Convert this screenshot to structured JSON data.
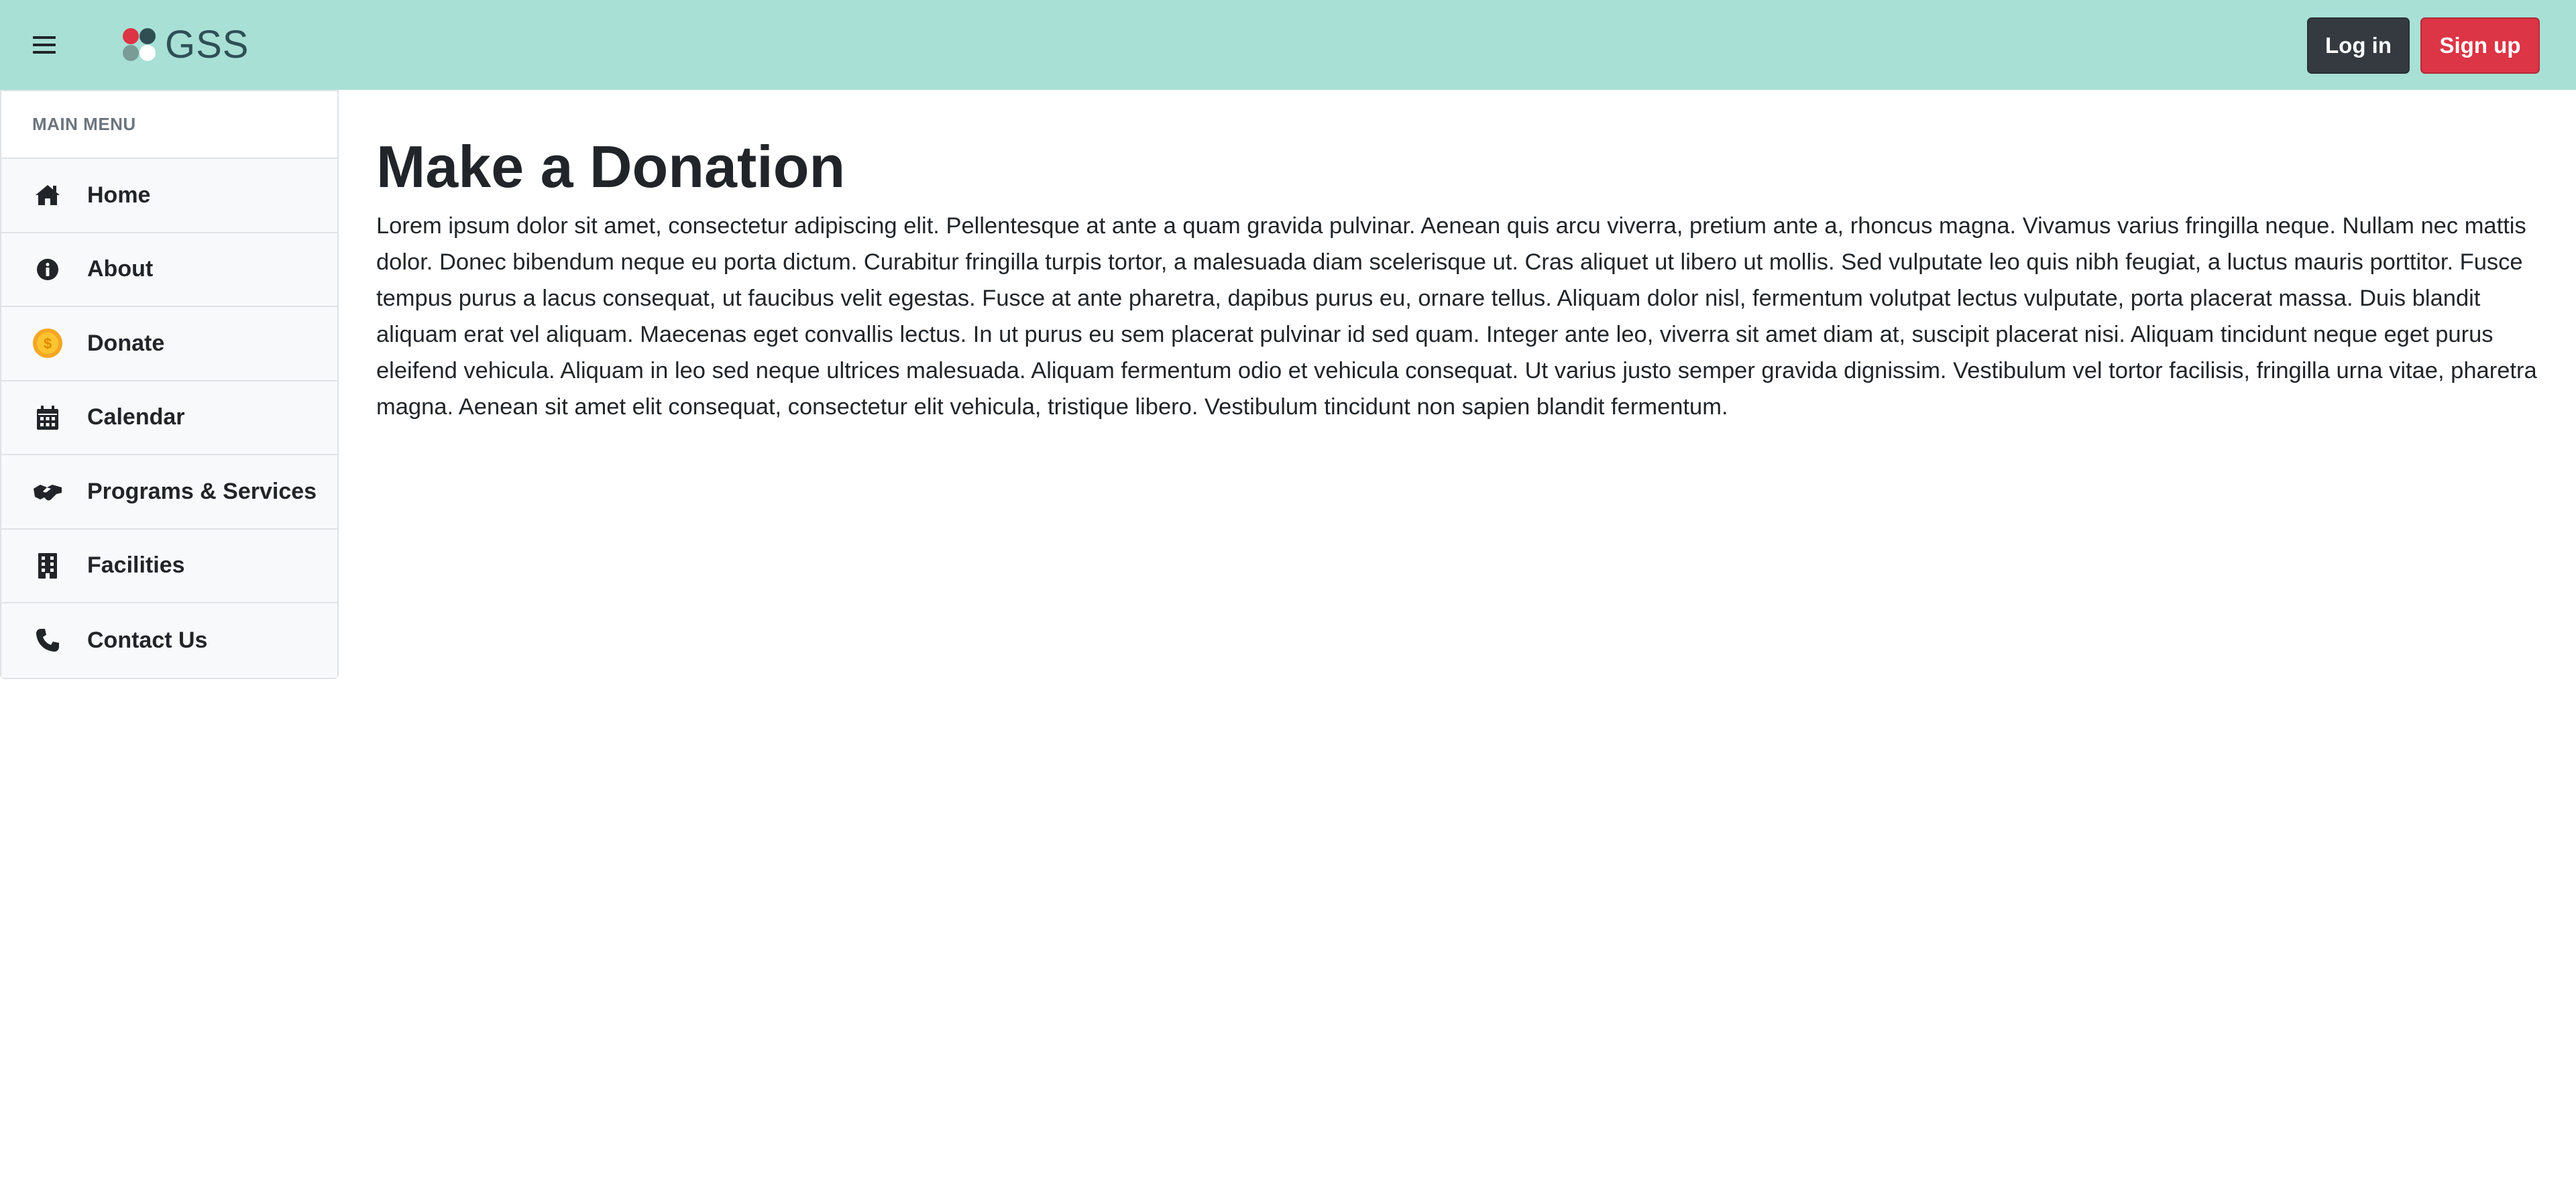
{
  "header": {
    "brand_text": "GSS",
    "login_label": "Log in",
    "signup_label": "Sign up",
    "menu_icon": "hamburger-icon",
    "logo_colors": [
      "#dc3545",
      "#2f4f55",
      "#7a9c97",
      "#ffffff"
    ],
    "background_color": "#a8e0d6"
  },
  "sidebar": {
    "header": "MAIN MENU",
    "items": [
      {
        "label": "Home",
        "icon": "home-icon"
      },
      {
        "label": "About",
        "icon": "info-icon"
      },
      {
        "label": "Donate",
        "icon": "coin-icon"
      },
      {
        "label": "Calendar",
        "icon": "calendar-icon"
      },
      {
        "label": "Programs & Services",
        "icon": "handshake-icon"
      },
      {
        "label": "Facilities",
        "icon": "building-icon"
      },
      {
        "label": "Contact Us",
        "icon": "phone-icon"
      }
    ]
  },
  "main": {
    "title": "Make a Donation",
    "body": "Lorem ipsum dolor sit amet, consectetur adipiscing elit. Pellentesque at ante a quam gravida pulvinar. Aenean quis arcu viverra, pretium ante a, rhoncus magna. Vivamus varius fringilla neque. Nullam nec mattis dolor. Donec bibendum neque eu porta dictum. Curabitur fringilla turpis tortor, a malesuada diam scelerisque ut. Cras aliquet ut libero ut mollis. Sed vulputate leo quis nibh feugiat, a luctus mauris porttitor. Fusce tempus purus a lacus consequat, ut faucibus velit egestas. Fusce at ante pharetra, dapibus purus eu, ornare tellus. Aliquam dolor nisl, fermentum volutpat lectus vulputate, porta placerat massa. Duis blandit aliquam erat vel aliquam. Maecenas eget convallis lectus. In ut purus eu sem placerat pulvinar id sed quam. Integer ante leo, viverra sit amet diam at, suscipit placerat nisi. Aliquam tincidunt neque eget purus eleifend vehicula. Aliquam in leo sed neque ultrices malesuada. Aliquam fermentum odio et vehicula consequat. Ut varius justo semper gravida dignissim. Vestibulum vel tortor facilisis, fringilla urna vitae, pharetra magna. Aenean sit amet elit consequat, consectetur elit vehicula, tristique libero. Vestibulum tincidunt non sapien blandit fermentum."
  }
}
